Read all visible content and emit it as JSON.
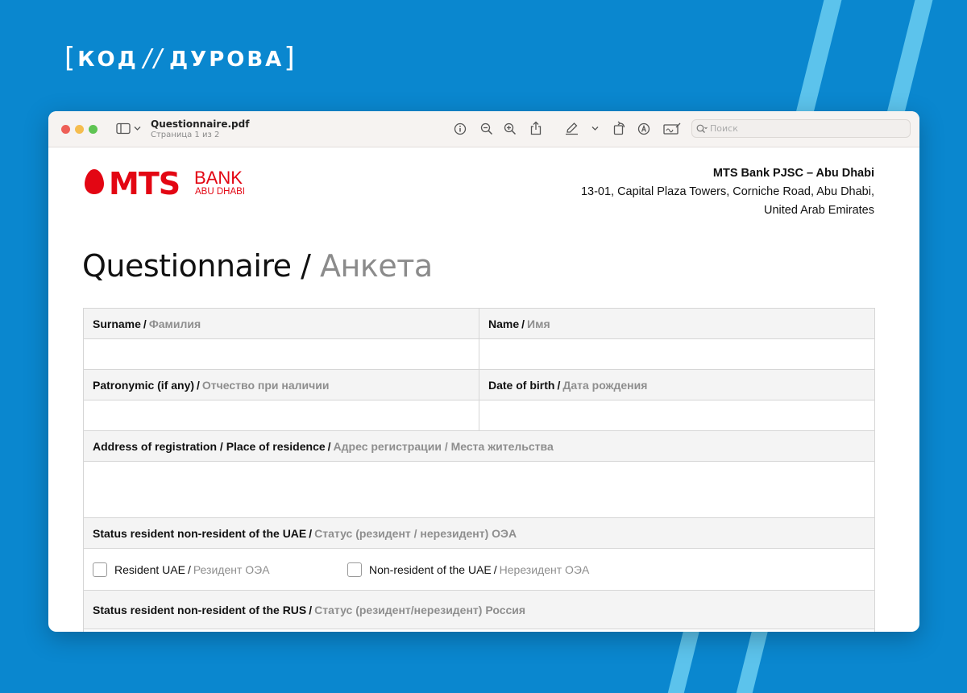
{
  "brand": {
    "left": "КОД",
    "right": "ДУРОВА"
  },
  "window": {
    "file_name": "Questionnaire.pdf",
    "page_info": "Страница 1 из 2",
    "search_placeholder": "Поиск"
  },
  "logo": {
    "main": "MTS",
    "bank": "BANK",
    "city": "ABU DHABI",
    "color": "#e30613"
  },
  "bank_info": {
    "name": "MTS Bank PJSC – Abu Dhabi",
    "address_line1": "13-01, Capital Plaza Towers, Corniche Road, Abu Dhabi,",
    "address_line2": "United Arab Emirates"
  },
  "heading": {
    "en": "Questionnaire",
    "sep": " / ",
    "ru": "Анкета"
  },
  "form": {
    "surname": {
      "en": "Surname",
      "ru": "Фамилия"
    },
    "name": {
      "en": "Name",
      "ru": "Имя"
    },
    "patronymic": {
      "en": "Patronymic (if any)",
      "ru": "Отчество при наличии"
    },
    "dob": {
      "en": "Date of birth",
      "ru": "Дата рождения"
    },
    "address": {
      "en": "Address of registration / Place of residence",
      "ru": "Адрес регистрации / Места жительства"
    },
    "status_uae": {
      "en": "Status resident non-resident of the UAE",
      "ru": "Статус (резидент / нерезидент) ОЭА"
    },
    "resident_uae": {
      "en": "Resident UAE",
      "ru": "Резидент ОЭА"
    },
    "nonresident_uae": {
      "en": "Non-resident of the UAE",
      "ru": "Нерезидент ОЭА"
    },
    "status_rus": {
      "en": "Status resident non-resident of the RUS",
      "ru": "Статус (резидент/нерезидент) Россия"
    }
  }
}
